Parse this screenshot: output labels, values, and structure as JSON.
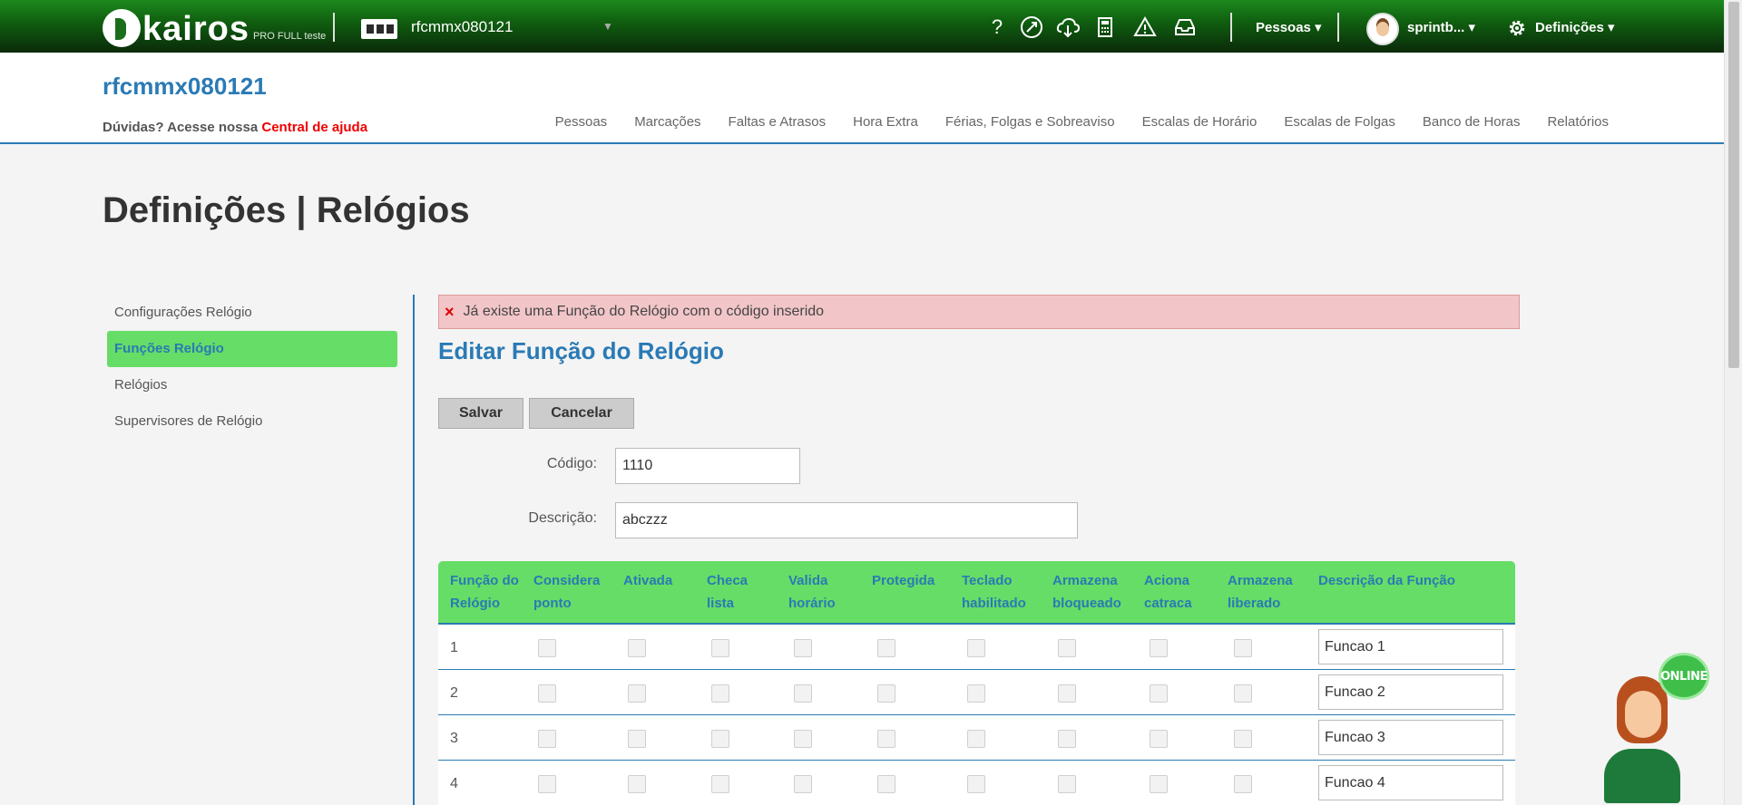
{
  "topbar": {
    "logo_text": "kairos",
    "logo_sub": "PRO FULL teste",
    "company": "rfcmmx080121",
    "icons": [
      "help-icon",
      "rocket-icon",
      "cloud-download-icon",
      "calculator-icon",
      "warning-icon",
      "inbox-icon"
    ],
    "help_glyph": "?",
    "pessoas": "Pessoas",
    "user": "sprintb...",
    "definicoes": "Definições"
  },
  "header": {
    "company_title": "rfcmmx080121",
    "help_prefix": "Dúvidas? Acesse nossa ",
    "help_link": "Central de ajuda",
    "nav": [
      "Pessoas",
      "Marcações",
      "Faltas e Atrasos",
      "Hora Extra",
      "Férias, Folgas e Sobreaviso",
      "Escalas de Horário",
      "Escalas de Folgas",
      "Banco de Horas",
      "Relatórios"
    ]
  },
  "page": {
    "title": "Definições | Relógios"
  },
  "sidebar": {
    "items": [
      {
        "label": "Configurações Relógio",
        "active": false
      },
      {
        "label": "Funções Relógio",
        "active": true
      },
      {
        "label": "Relógios",
        "active": false
      },
      {
        "label": "Supervisores de Relógio",
        "active": false
      }
    ]
  },
  "alert": {
    "icon": "×",
    "message": "Já existe uma Função do Relógio com o código inserido"
  },
  "form": {
    "title": "Editar Função do Relógio",
    "save_label": "Salvar",
    "cancel_label": "Cancelar",
    "codigo_label": "Código:",
    "codigo_value": "1110",
    "descricao_label": "Descrição:",
    "descricao_value": "abczzz"
  },
  "grid": {
    "headers": [
      [
        "Função do",
        "Relógio"
      ],
      [
        "Considera",
        "ponto"
      ],
      [
        "Ativada",
        ""
      ],
      [
        "Checa",
        "lista"
      ],
      [
        "Valida",
        "horário"
      ],
      [
        "Protegida",
        ""
      ],
      [
        "Teclado",
        "habilitado"
      ],
      [
        "Armazena",
        "bloqueado"
      ],
      [
        "Aciona",
        "catraca"
      ],
      [
        "Armazena",
        "liberado"
      ],
      [
        "Descrição da Função",
        ""
      ]
    ],
    "rows": [
      {
        "num": "1",
        "desc": "Funcao 1"
      },
      {
        "num": "2",
        "desc": "Funcao 2"
      },
      {
        "num": "3",
        "desc": "Funcao 3"
      },
      {
        "num": "4",
        "desc": "Funcao 4"
      }
    ]
  },
  "chat": {
    "badge": "ONLINE"
  },
  "colors": {
    "accent": "#2a7ab5",
    "green": "#66dd66",
    "alert_bg": "#f2c6c8",
    "link_red": "#e00000"
  }
}
